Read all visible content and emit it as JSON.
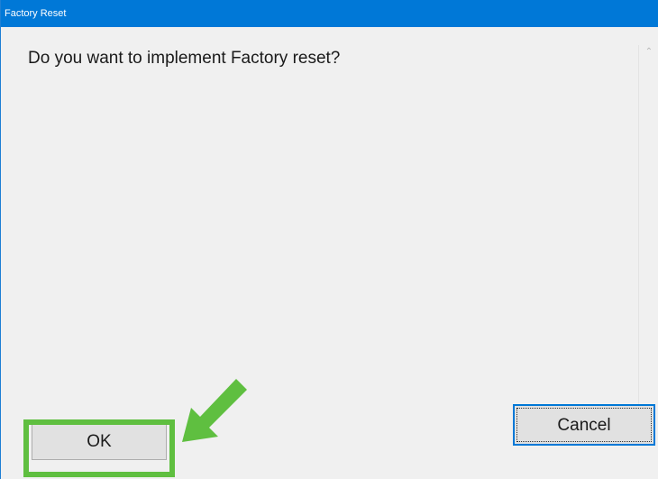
{
  "window": {
    "title": "Factory Reset"
  },
  "dialog": {
    "message": "Do you want to implement Factory reset?"
  },
  "buttons": {
    "ok_label": "OK",
    "cancel_label": "Cancel"
  },
  "icons": {
    "scroll_up": "chevron-up-icon",
    "scroll_down": "chevron-down-icon",
    "annotation": "arrow-icon"
  },
  "colors": {
    "titlebar": "#0078d7",
    "highlight": "#5fbf40",
    "focus_border": "#0078d7"
  }
}
